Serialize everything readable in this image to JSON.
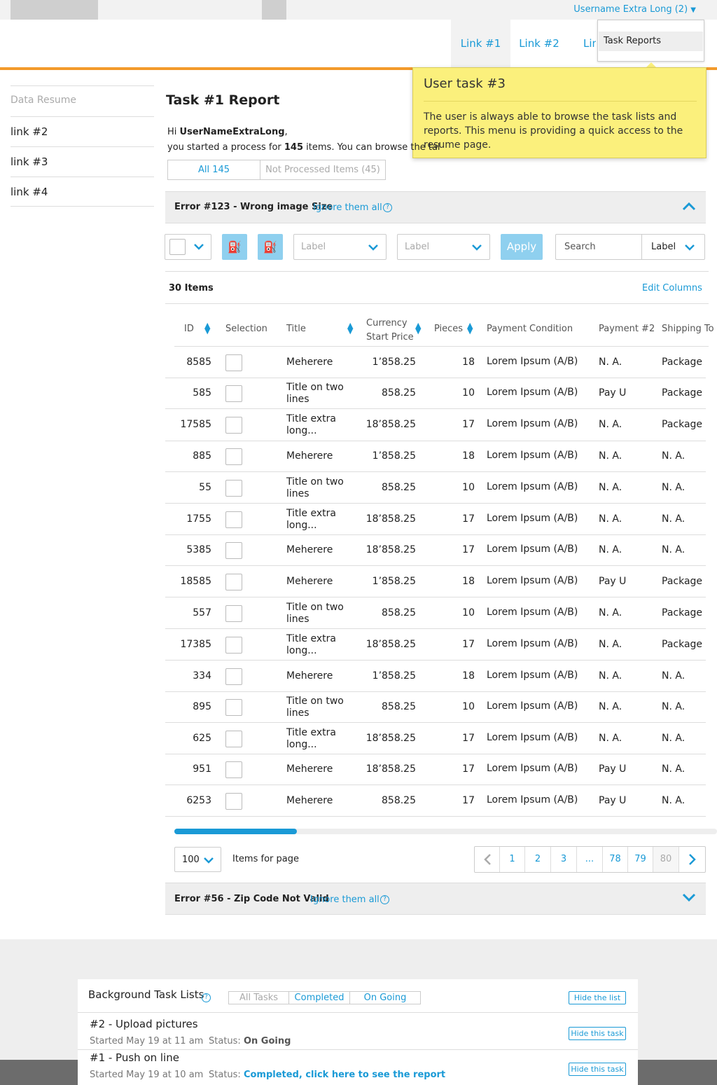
{
  "header": {
    "user_menu": "Username Extra Long (2)",
    "nav": [
      "Link #1",
      "Link #2",
      "Lin"
    ],
    "dropdown_item": "Task Reports"
  },
  "tooltip": {
    "title": "User task #3",
    "body": "The user is always able to browse the task lists and reports. This menu is providing a quick access to the resume page."
  },
  "sidebar": {
    "title": "Data Resume",
    "items": [
      "link #2",
      "link #3",
      "link #4"
    ]
  },
  "main": {
    "title": "Task #1 Report",
    "greeting_hi": "Hi",
    "username": "UserNameExtraLong",
    "greeting_line2_a": "you started a process for",
    "item_count": "145",
    "greeting_line2_b": "items. You can browse the tal",
    "tabs": [
      "All 145",
      "Not Processed Items (45)"
    ]
  },
  "error1": {
    "title": "Error #123 - Wrong image Size",
    "link": "Ignore them all"
  },
  "error2": {
    "title": "Error #56 - Zip Code Not Valid",
    "link": "Ignore them all"
  },
  "toolbar": {
    "label1": "Label",
    "label2": "Label",
    "apply": "Apply",
    "search_placeholder": "Search",
    "search_label": "Label"
  },
  "table": {
    "items_count": "30 Items",
    "edit_columns": "Edit Columns",
    "headers": {
      "id": "ID",
      "selection": "Selection",
      "title": "Title",
      "currency": "Currency",
      "start_price": "Start Price",
      "pieces": "Pieces",
      "payment_condition": "Payment Condition",
      "payment2": "Payment #2",
      "shipping": "Shipping To"
    },
    "rows": [
      {
        "id": "8585",
        "title": [
          "Meherere"
        ],
        "price": "1’858.25",
        "pieces": "18",
        "cond": "Lorem Ipsum (A/B)",
        "pay": "N. A.",
        "ship": "Package E"
      },
      {
        "id": "585",
        "title": [
          "Title on two",
          "lines"
        ],
        "price": "858.25",
        "pieces": "10",
        "cond": "Lorem Ipsum (A/B)",
        "pay": "Pay U",
        "ship": "Package E"
      },
      {
        "id": "17585",
        "title": [
          "Title extra",
          "long..."
        ],
        "price": "18’858.25",
        "pieces": "17",
        "cond": "Lorem Ipsum (A/B)",
        "pay": "N. A.",
        "ship": "Package E"
      },
      {
        "id": "885",
        "title": [
          "Meherere"
        ],
        "price": "1’858.25",
        "pieces": "18",
        "cond": "Lorem Ipsum (A/B)",
        "pay": "N. A.",
        "ship": "N. A."
      },
      {
        "id": "55",
        "title": [
          "Title on two",
          "lines"
        ],
        "price": "858.25",
        "pieces": "10",
        "cond": "Lorem Ipsum (A/B)",
        "pay": "N. A.",
        "ship": "N. A."
      },
      {
        "id": "1755",
        "title": [
          "Title extra",
          "long..."
        ],
        "price": "18’858.25",
        "pieces": "17",
        "cond": "Lorem Ipsum (A/B)",
        "pay": "N. A.",
        "ship": "N. A."
      },
      {
        "id": "5385",
        "title": [
          "Meherere"
        ],
        "price": "18’858.25",
        "pieces": "17",
        "cond": "Lorem Ipsum (A/B)",
        "pay": "N. A.",
        "ship": "N. A."
      },
      {
        "id": "18585",
        "title": [
          "Meherere"
        ],
        "price": "1’858.25",
        "pieces": "18",
        "cond": "Lorem Ipsum (A/B)",
        "pay": "Pay U",
        "ship": "Package E"
      },
      {
        "id": "557",
        "title": [
          "Title on two",
          "lines"
        ],
        "price": "858.25",
        "pieces": "10",
        "cond": "Lorem Ipsum (A/B)",
        "pay": "N. A.",
        "ship": "Package E"
      },
      {
        "id": "17385",
        "title": [
          "Title extra",
          "long..."
        ],
        "price": "18’858.25",
        "pieces": "17",
        "cond": "Lorem Ipsum (A/B)",
        "pay": "N. A.",
        "ship": "Package E"
      },
      {
        "id": "334",
        "title": [
          "Meherere"
        ],
        "price": "1’858.25",
        "pieces": "18",
        "cond": "Lorem Ipsum (A/B)",
        "pay": "N. A.",
        "ship": "N. A."
      },
      {
        "id": "895",
        "title": [
          "Title on two",
          "lines"
        ],
        "price": "858.25",
        "pieces": "10",
        "cond": "Lorem Ipsum (A/B)",
        "pay": "N. A.",
        "ship": "N. A."
      },
      {
        "id": "625",
        "title": [
          "Title extra",
          "long..."
        ],
        "price": "18’858.25",
        "pieces": "17",
        "cond": "Lorem Ipsum (A/B)",
        "pay": "N. A.",
        "ship": "N. A."
      },
      {
        "id": "951",
        "title": [
          "Meherere"
        ],
        "price": "18’858.25",
        "pieces": "17",
        "cond": "Lorem Ipsum (A/B)",
        "pay": "Pay U",
        "ship": "N. A."
      },
      {
        "id": "6253",
        "title": [
          "Meherere"
        ],
        "price": "858.25",
        "pieces": "17",
        "cond": "Lorem Ipsum (A/B)",
        "pay": "Pay U",
        "ship": "N. A."
      }
    ]
  },
  "pagination": {
    "per_page": "100",
    "per_page_label": "Items for page",
    "pages": [
      "1",
      "2",
      "3",
      "...",
      "78",
      "79",
      "80"
    ]
  },
  "background_tasks": {
    "title": "Background Task Lists",
    "tabs": [
      "All Tasks",
      "Completed",
      "On Going"
    ],
    "hide_list": "Hide the list",
    "tasks": [
      {
        "name": "#2 - Upload pictures",
        "started": "Started May 19 at 11 am",
        "status_label": "Status:",
        "status": "On Going",
        "hide": "Hide this task"
      },
      {
        "name": "#1 - Push on line",
        "started": "Started May 19 at 10 am",
        "status_label": "Status:",
        "status": "Completed, click here to see the report",
        "hide": "Hide this task"
      }
    ]
  },
  "colors": {
    "accent": "#1a9ad6",
    "orange": "#f39a2b",
    "tooltip": "#fbf07c"
  }
}
